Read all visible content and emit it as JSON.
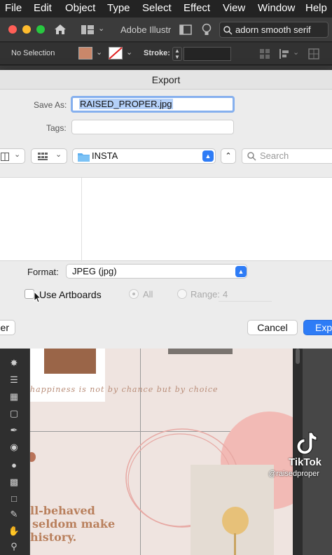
{
  "menubar": {
    "items": [
      "File",
      "Edit",
      "Object",
      "Type",
      "Select",
      "Effect",
      "View",
      "Window",
      "Help"
    ]
  },
  "appbar": {
    "title": "Adobe Illustr",
    "search_value": "adorn smooth serif"
  },
  "controlbar": {
    "selection": "No Selection",
    "stroke_label": "Stroke:"
  },
  "dialog": {
    "title": "Export",
    "save_as_label": "Save As:",
    "save_as_value": "RAISED_PROPER.jpg",
    "tags_label": "Tags:",
    "location": "INSTA",
    "search_placeholder": "Search",
    "format_label": "Format:",
    "format_value": "JPEG (jpg)",
    "use_artboards_label": "Use Artboards",
    "all_label": "All",
    "range_label": "Range:",
    "range_value": "4",
    "new_folder_label": "er",
    "cancel_label": "Cancel",
    "export_label": "Expo"
  },
  "artboard": {
    "quote": "happiness is not by chance but by choice",
    "headline_lines": [
      "ll-behaved",
      "seldom make",
      "history."
    ]
  },
  "watermark": {
    "brand": "TikTok",
    "handle": "@raisedproper"
  },
  "colors": {
    "accent": "#2e7cf6",
    "fill_swatch": "#c9876a",
    "headline": "#b9805d"
  }
}
